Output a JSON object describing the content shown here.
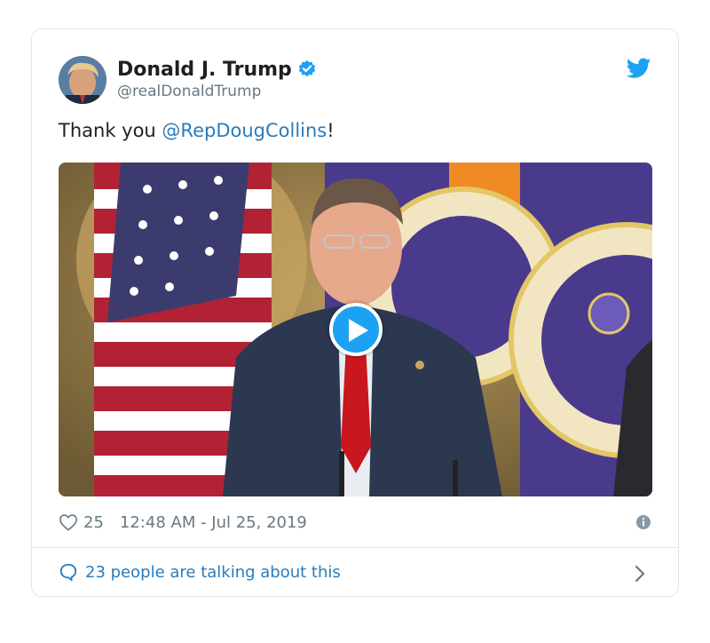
{
  "author": {
    "display_name": "Donald J. Trump",
    "handle": "@realDonaldTrump",
    "verified": true
  },
  "tweet": {
    "text_before": "Thank you ",
    "mention": "@RepDougCollins",
    "text_after": "!"
  },
  "media": {
    "type": "video",
    "play_icon": "play-icon"
  },
  "meta": {
    "like_count": "25",
    "timestamp": "12:48 AM - Jul 25, 2019"
  },
  "footer": {
    "talking_label": "23 people are talking about this"
  },
  "colors": {
    "link": "#2b7bb9",
    "brand": "#1da1f2",
    "muted": "#697882",
    "border": "#e1e8ed"
  },
  "icons": {
    "verified": "verified-badge-icon",
    "brand": "twitter-bird-icon",
    "like": "heart-icon",
    "info": "info-icon",
    "reply": "speech-bubble-icon",
    "chevron": "chevron-right-icon"
  }
}
